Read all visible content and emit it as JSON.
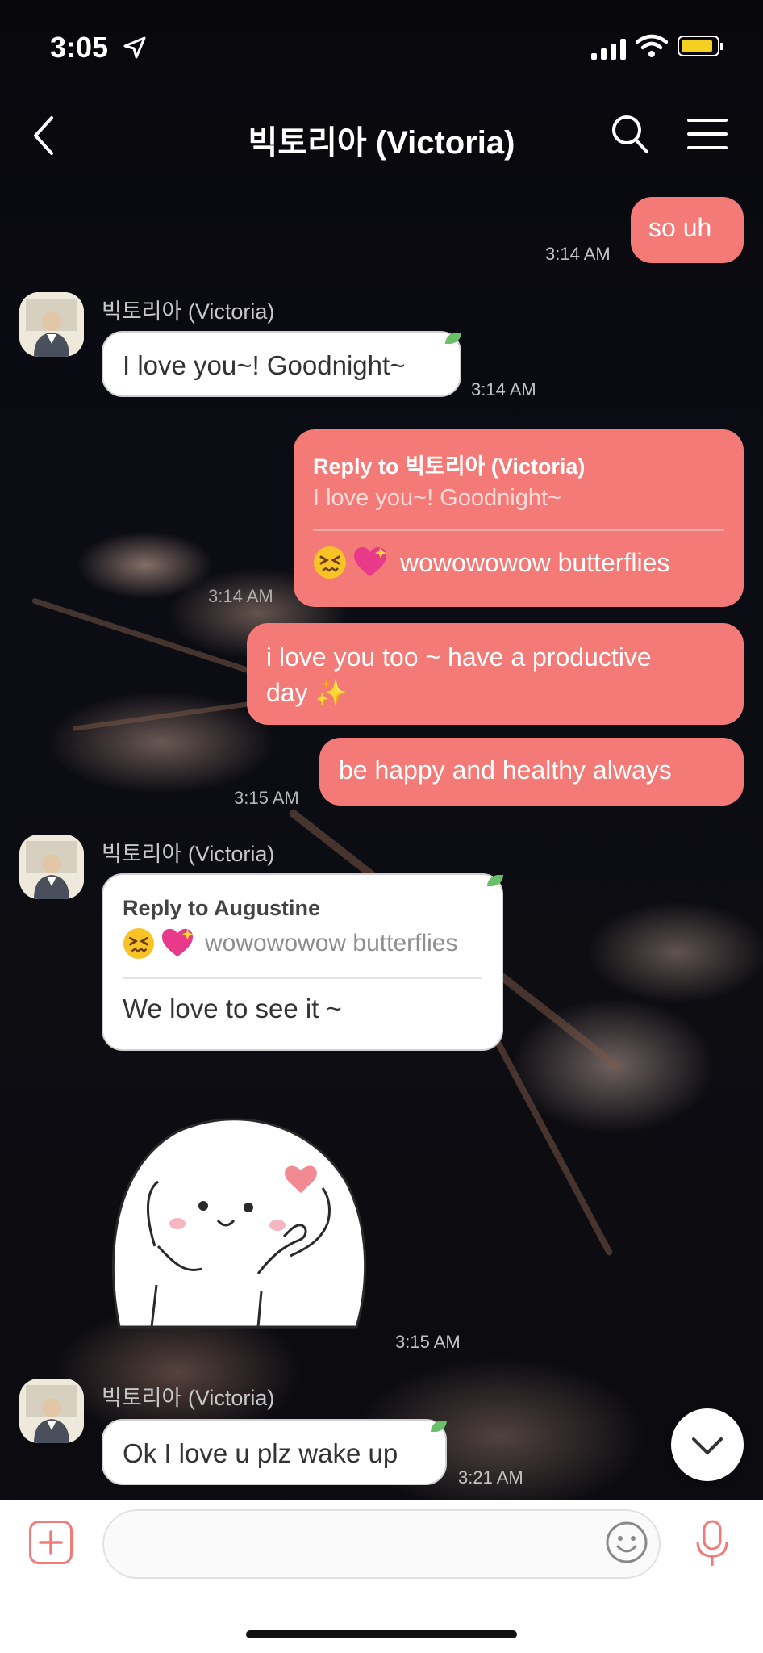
{
  "status_bar": {
    "time": "3:05",
    "battery_color": "#f5d020"
  },
  "header": {
    "title": "빅토리아 (Victoria)"
  },
  "colors": {
    "outgoing_bubble": "#f47a77",
    "incoming_bubble": "#ffffff",
    "accent": "#f47a77"
  },
  "messages": {
    "m1": {
      "text": "so uh",
      "time": "3:14 AM"
    },
    "m2": {
      "sender": "빅토리아 (Victoria)",
      "text": "I love you~! Goodnight~",
      "time": "3:14 AM"
    },
    "m3": {
      "reply_to": "Reply to 빅토리아 (Victoria)",
      "quoted": "I love you~! Goodnight~",
      "text": "wowowowow butterflies",
      "time": "3:14 AM"
    },
    "m4": {
      "line1": "i love you too ~ have a productive",
      "line2": "day ✨"
    },
    "m5": {
      "text": "be happy and healthy always",
      "time": "3:15 AM"
    },
    "m6": {
      "sender": "빅토리아 (Victoria)",
      "reply_to": "Reply to Augustine",
      "quoted": "wowowowow butterflies",
      "text": "We love to see it ~"
    },
    "m7": {
      "type": "sticker",
      "time": "3:15 AM"
    },
    "m8": {
      "sender": "빅토리아 (Victoria)",
      "text": "Ok I love u plz wake up",
      "time": "3:21 AM"
    }
  },
  "icons": [
    "location-arrow-icon",
    "signal-icon",
    "wifi-icon",
    "battery-icon",
    "back-chevron-icon",
    "search-icon",
    "menu-icon",
    "chevron-down-icon",
    "plus-icon",
    "emoji-icon",
    "microphone-icon"
  ]
}
